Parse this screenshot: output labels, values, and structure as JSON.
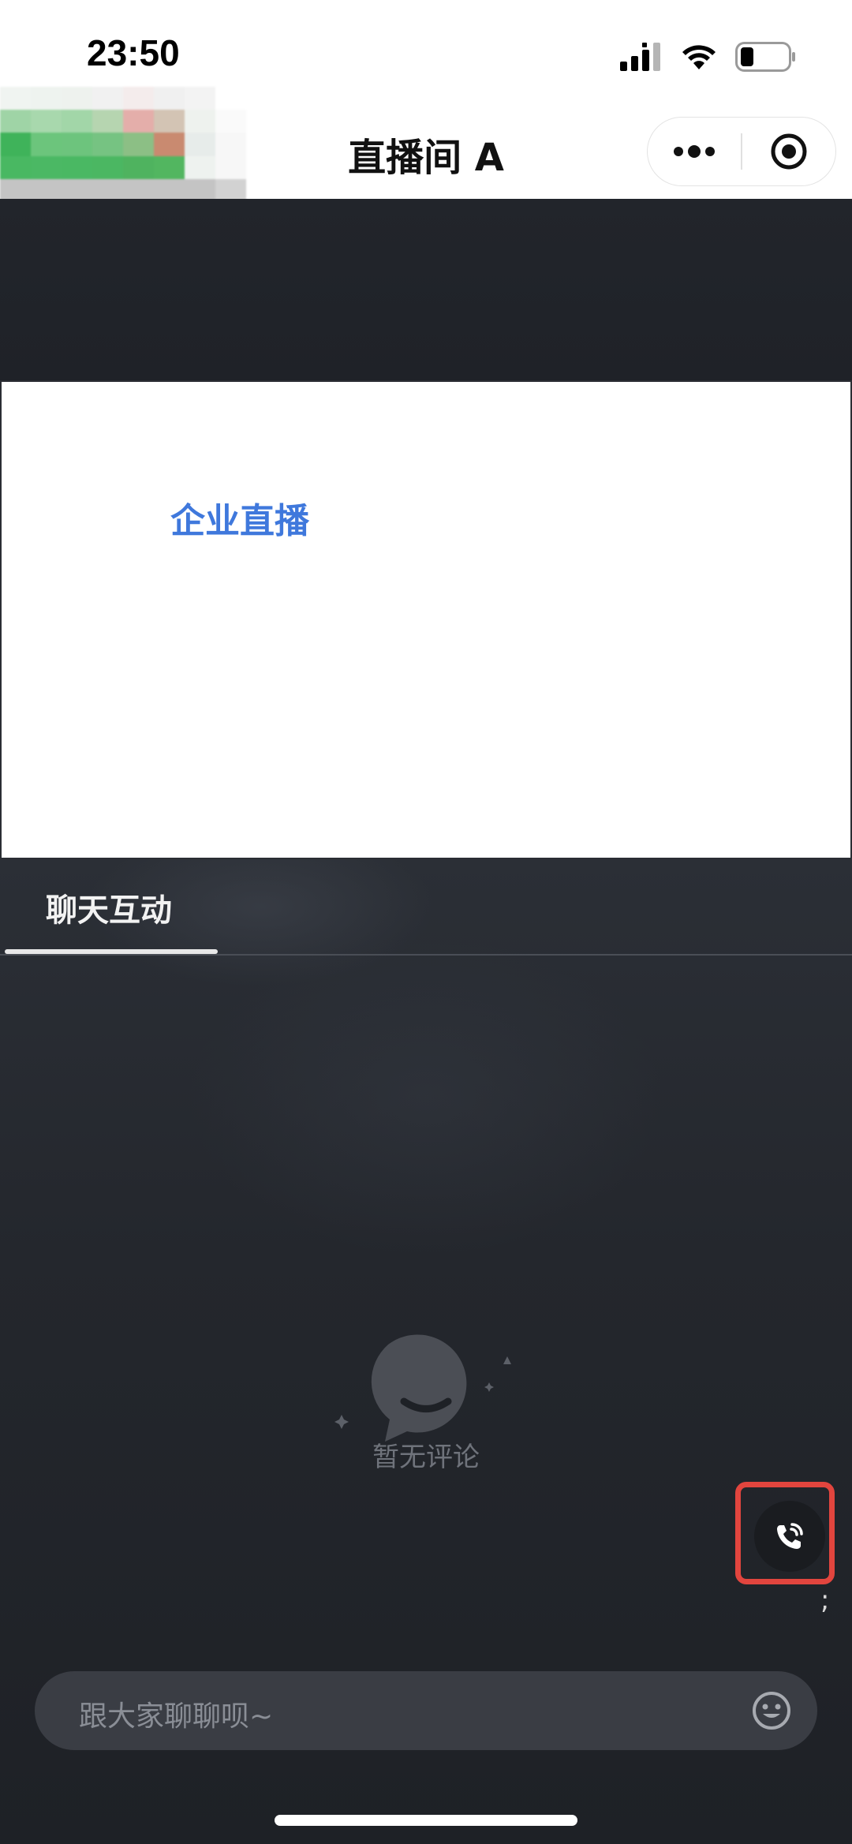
{
  "status_bar": {
    "time": "23:50",
    "icons": [
      "cellular-signal-icon",
      "wifi-icon",
      "battery-icon"
    ]
  },
  "nav": {
    "title": "直播间 A",
    "capsule_icons": [
      "more-icon",
      "close-target-icon"
    ]
  },
  "slide": {
    "title": "企业直播"
  },
  "chat": {
    "tab_label": "聊天互动",
    "empty_text": "暂无评论",
    "input_placeholder": "跟大家聊聊呗~"
  },
  "floating": {
    "call_icon": "phone-call-icon",
    "trailing_mark": ";"
  },
  "colors": {
    "accent_blue": "#3f78dc",
    "highlight_red": "#e2453e",
    "dark_bg": "#1d1f24"
  }
}
